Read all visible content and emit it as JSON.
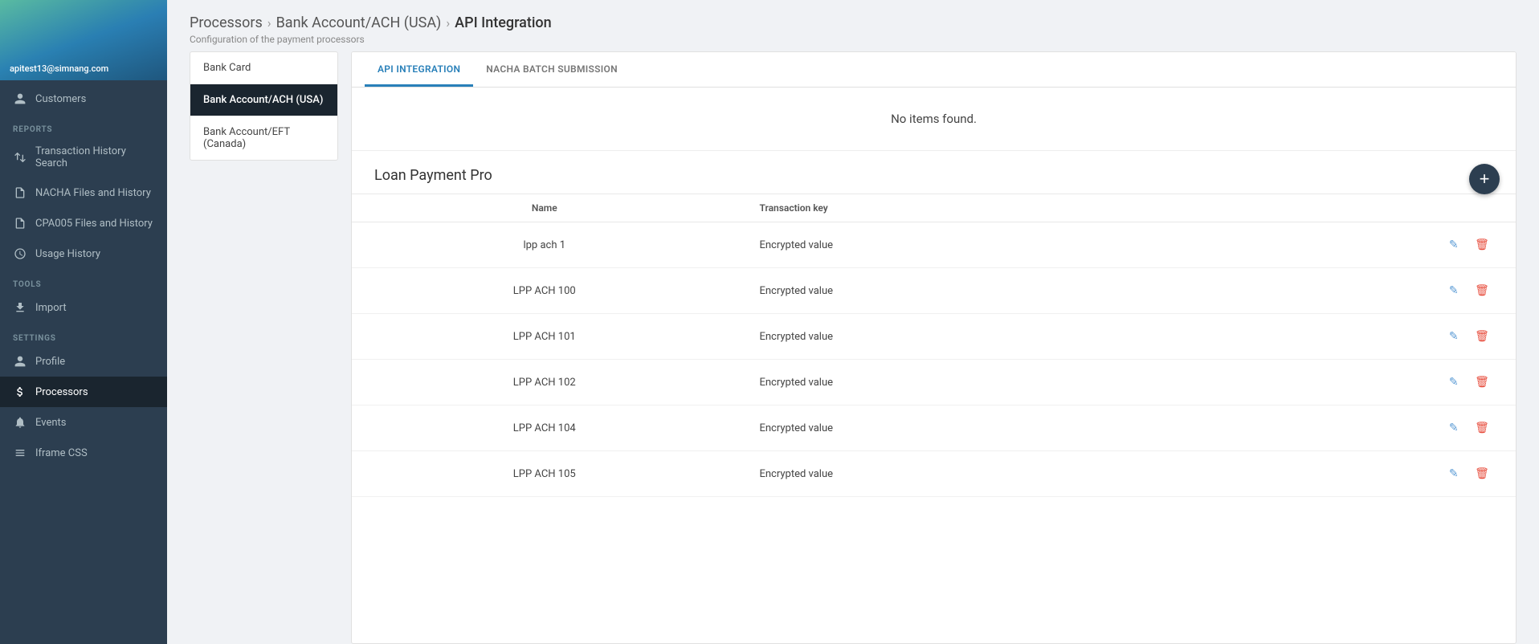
{
  "sidebar": {
    "user_email": "apitest13@simnang.com",
    "sections": [
      {
        "type": "item",
        "label": "Customers",
        "name": "customers",
        "icon": "person"
      },
      {
        "type": "section",
        "label": "REPORTS"
      },
      {
        "type": "item",
        "label": "Transaction History Search",
        "name": "transaction-history-search",
        "icon": "swap"
      },
      {
        "type": "item",
        "label": "NACHA Files and History",
        "name": "nacha-files",
        "icon": "file"
      },
      {
        "type": "item",
        "label": "CPA005 Files and History",
        "name": "cpa005-files",
        "icon": "file"
      },
      {
        "type": "item",
        "label": "Usage History",
        "name": "usage-history",
        "icon": "clock"
      },
      {
        "type": "section",
        "label": "TOOLS"
      },
      {
        "type": "item",
        "label": "Import",
        "name": "import",
        "icon": "import"
      },
      {
        "type": "section",
        "label": "SETTINGS"
      },
      {
        "type": "item",
        "label": "Profile",
        "name": "profile",
        "icon": "person"
      },
      {
        "type": "item",
        "label": "Processors",
        "name": "processors",
        "icon": "dollar",
        "active": true
      },
      {
        "type": "item",
        "label": "Events",
        "name": "events",
        "icon": "bell"
      },
      {
        "type": "item",
        "label": "Iframe CSS",
        "name": "iframe-css",
        "icon": "hash"
      }
    ]
  },
  "breadcrumb": {
    "parts": [
      "Processors",
      "Bank Account/ACH (USA)",
      "API Integration"
    ],
    "subtitle": "Configuration of the payment processors"
  },
  "left_panel": {
    "items": [
      {
        "label": "Bank Card",
        "name": "bank-card",
        "active": false
      },
      {
        "label": "Bank Account/ACH (USA)",
        "name": "bank-account-ach-usa",
        "active": true
      },
      {
        "label": "Bank Account/EFT (Canada)",
        "name": "bank-account-eft-canada",
        "active": false
      }
    ]
  },
  "tabs": [
    {
      "label": "API INTEGRATION",
      "name": "api-integration",
      "active": true
    },
    {
      "label": "NACHA BATCH SUBMISSION",
      "name": "nacha-batch-submission",
      "active": false
    }
  ],
  "no_items_text": "No items found.",
  "section_title": "Loan Payment Pro",
  "add_button_label": "+",
  "table": {
    "columns": [
      {
        "key": "name",
        "label": "Name"
      },
      {
        "key": "transaction_key",
        "label": "Transaction key"
      }
    ],
    "rows": [
      {
        "name": "lpp ach 1",
        "transaction_key": "Encrypted value"
      },
      {
        "name": "LPP ACH 100",
        "transaction_key": "Encrypted value"
      },
      {
        "name": "LPP ACH 101",
        "transaction_key": "Encrypted value"
      },
      {
        "name": "LPP ACH 102",
        "transaction_key": "Encrypted value"
      },
      {
        "name": "LPP ACH 104",
        "transaction_key": "Encrypted value"
      },
      {
        "name": "LPP ACH 105",
        "transaction_key": "Encrypted value"
      }
    ]
  }
}
